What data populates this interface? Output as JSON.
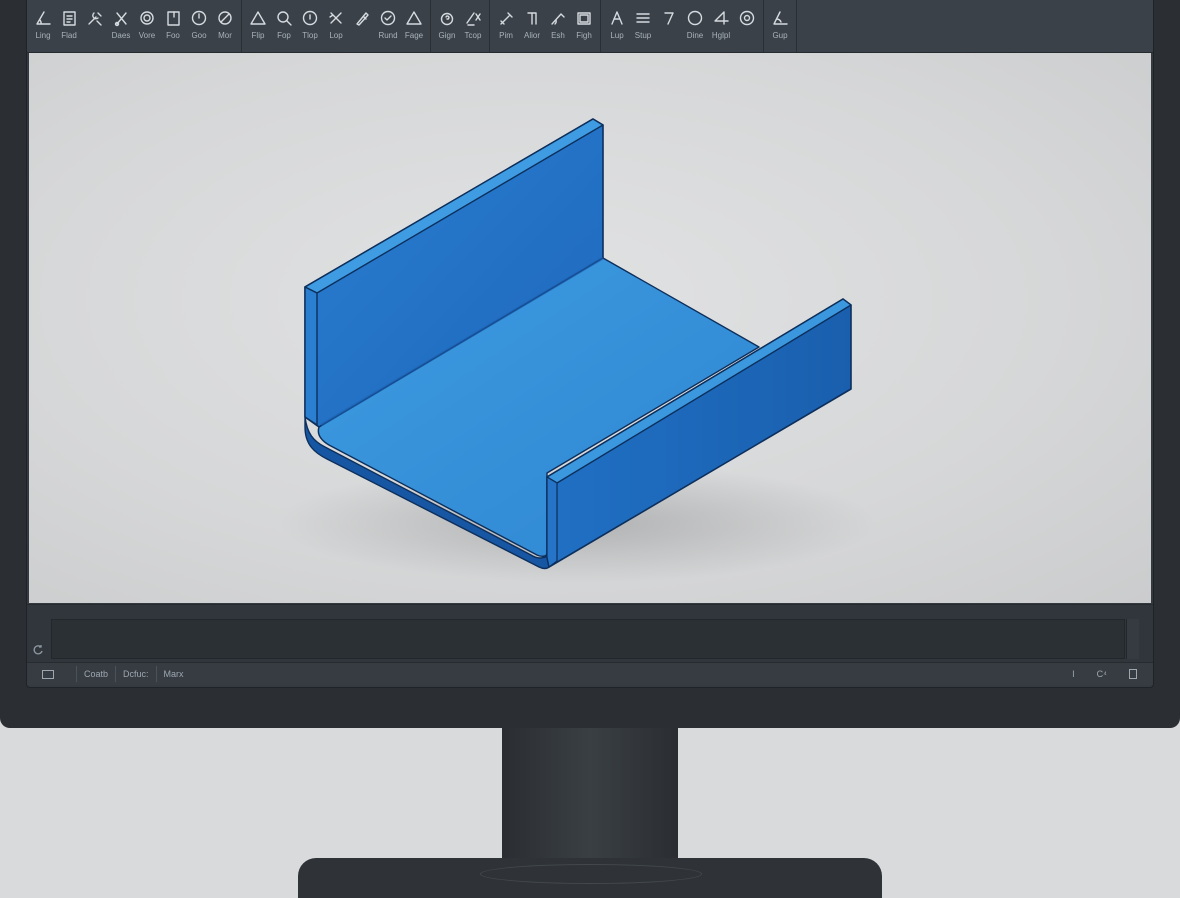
{
  "toolbar": {
    "groups": [
      [
        {
          "label": "Ling",
          "icon": "angle-line-icon"
        },
        {
          "label": "Flad",
          "icon": "clipboard-icon"
        },
        {
          "label": "",
          "icon": "tools-icon"
        },
        {
          "label": "Daes",
          "icon": "scissors-icon"
        },
        {
          "label": "Vore",
          "icon": "circle-icon"
        },
        {
          "label": "Foo",
          "icon": "page-icon"
        },
        {
          "label": "Goo",
          "icon": "clock-icon"
        },
        {
          "label": "Mor",
          "icon": "edit-icon"
        }
      ],
      [
        {
          "label": "Flip",
          "icon": "triangle-icon"
        },
        {
          "label": "Fop",
          "icon": "search-icon"
        },
        {
          "label": "Tlop",
          "icon": "info-circle-icon"
        },
        {
          "label": "Lop",
          "icon": "cross-arrows-icon"
        },
        {
          "label": "",
          "icon": "pen-icon"
        },
        {
          "label": "Rund",
          "icon": "target-icon"
        },
        {
          "label": "Fage",
          "icon": "triangle-outline-icon"
        }
      ],
      [
        {
          "label": "Gign",
          "icon": "question-circle-icon"
        },
        {
          "label": "Tcop",
          "icon": "pencil-x-icon"
        }
      ],
      [
        {
          "label": "Pim",
          "icon": "wrench-icon"
        },
        {
          "label": "Alior",
          "icon": "bracket-icon"
        },
        {
          "label": "Esh",
          "icon": "measure-icon"
        },
        {
          "label": "Figh",
          "icon": "frame-icon"
        }
      ],
      [
        {
          "label": "Lup",
          "icon": "compass-icon"
        },
        {
          "label": "Stup",
          "icon": "lines-icon"
        },
        {
          "label": "",
          "icon": "hook-icon"
        },
        {
          "label": "Dine",
          "icon": "circle-outline-icon"
        },
        {
          "label": "Hglpl",
          "icon": "four-icon"
        },
        {
          "label": "",
          "icon": "at-icon"
        }
      ],
      [
        {
          "label": "Gup",
          "icon": "angle-icon"
        }
      ]
    ]
  },
  "viewport": {
    "model": "sheet-metal-u-channel",
    "colors": {
      "top": "#3391d8",
      "side": "#1f6cc3",
      "dark": "#1656a3",
      "edge": "#0d2f5c"
    }
  },
  "statusbar": {
    "tabs": [
      "Coatb",
      "Dcfuc:",
      "Marx"
    ],
    "right_items": [
      "I",
      "C⁴"
    ]
  }
}
